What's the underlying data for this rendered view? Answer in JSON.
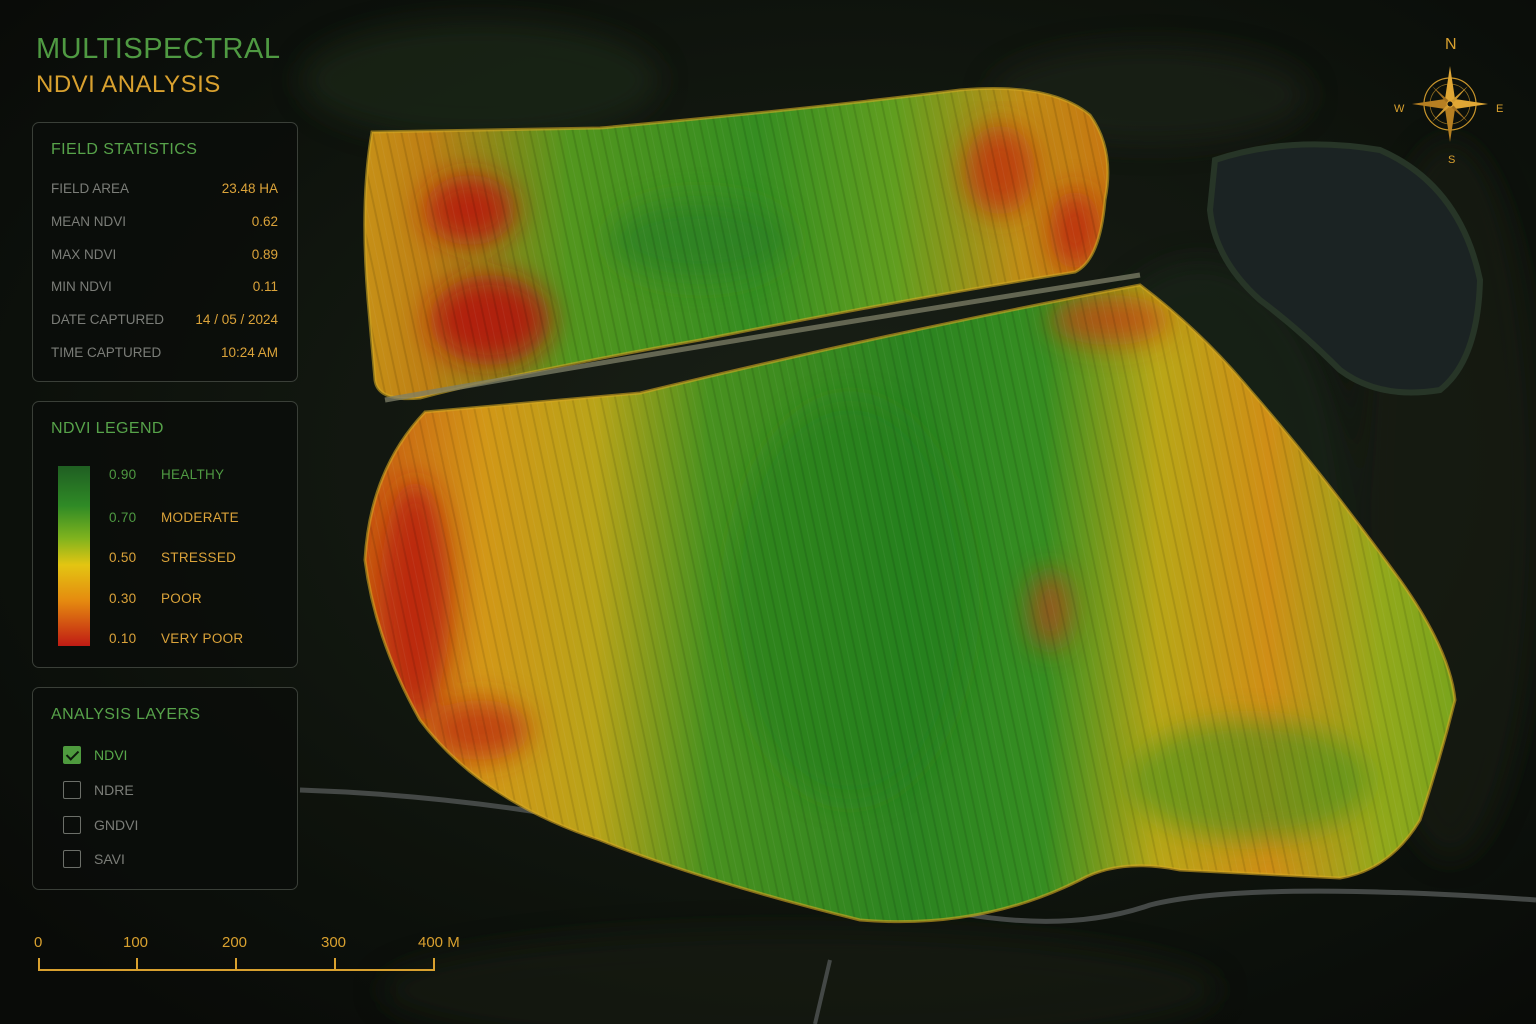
{
  "header": {
    "title_line1": "MULTISPECTRAL",
    "title_line2": "NDVI ANALYSIS"
  },
  "field_statistics": {
    "title": "FIELD STATISTICS",
    "rows": [
      {
        "label": "FIELD AREA",
        "value": "23.48 HA"
      },
      {
        "label": "MEAN NDVI",
        "value": "0.62"
      },
      {
        "label": "MAX NDVI",
        "value": "0.89"
      },
      {
        "label": "MIN NDVI",
        "value": "0.11"
      },
      {
        "label": "DATE CAPTURED",
        "value": "14 / 05 / 2024"
      },
      {
        "label": "TIME CAPTURED",
        "value": "10:24 AM"
      }
    ]
  },
  "legend": {
    "title": "NDVI LEGEND",
    "items": [
      {
        "value": "0.90",
        "label": "HEALTHY"
      },
      {
        "value": "0.70",
        "label": "MODERATE"
      },
      {
        "value": "0.50",
        "label": "STRESSED"
      },
      {
        "value": "0.30",
        "label": "POOR"
      },
      {
        "value": "0.10",
        "label": "VERY POOR"
      }
    ],
    "colors": [
      "#1f5e22",
      "#2f8a26",
      "#e3c512",
      "#e58a10",
      "#c01b14"
    ]
  },
  "analysis_layers": {
    "title": "ANALYSIS LAYERS",
    "items": [
      {
        "label": "NDVI",
        "checked": true
      },
      {
        "label": "NDRE",
        "checked": false
      },
      {
        "label": "GNDVI",
        "checked": false
      },
      {
        "label": "SAVI",
        "checked": false
      }
    ]
  },
  "scale_bar": {
    "labels": [
      "0",
      "100",
      "200",
      "300",
      "400 M"
    ]
  },
  "compass": {
    "north": "N",
    "east": "E",
    "south": "S",
    "west": "W",
    "icon": "compass-rose-icon"
  },
  "colors": {
    "accent_green": "#4f9a42",
    "accent_gold": "#d9a12f",
    "background": "#0e110d"
  }
}
